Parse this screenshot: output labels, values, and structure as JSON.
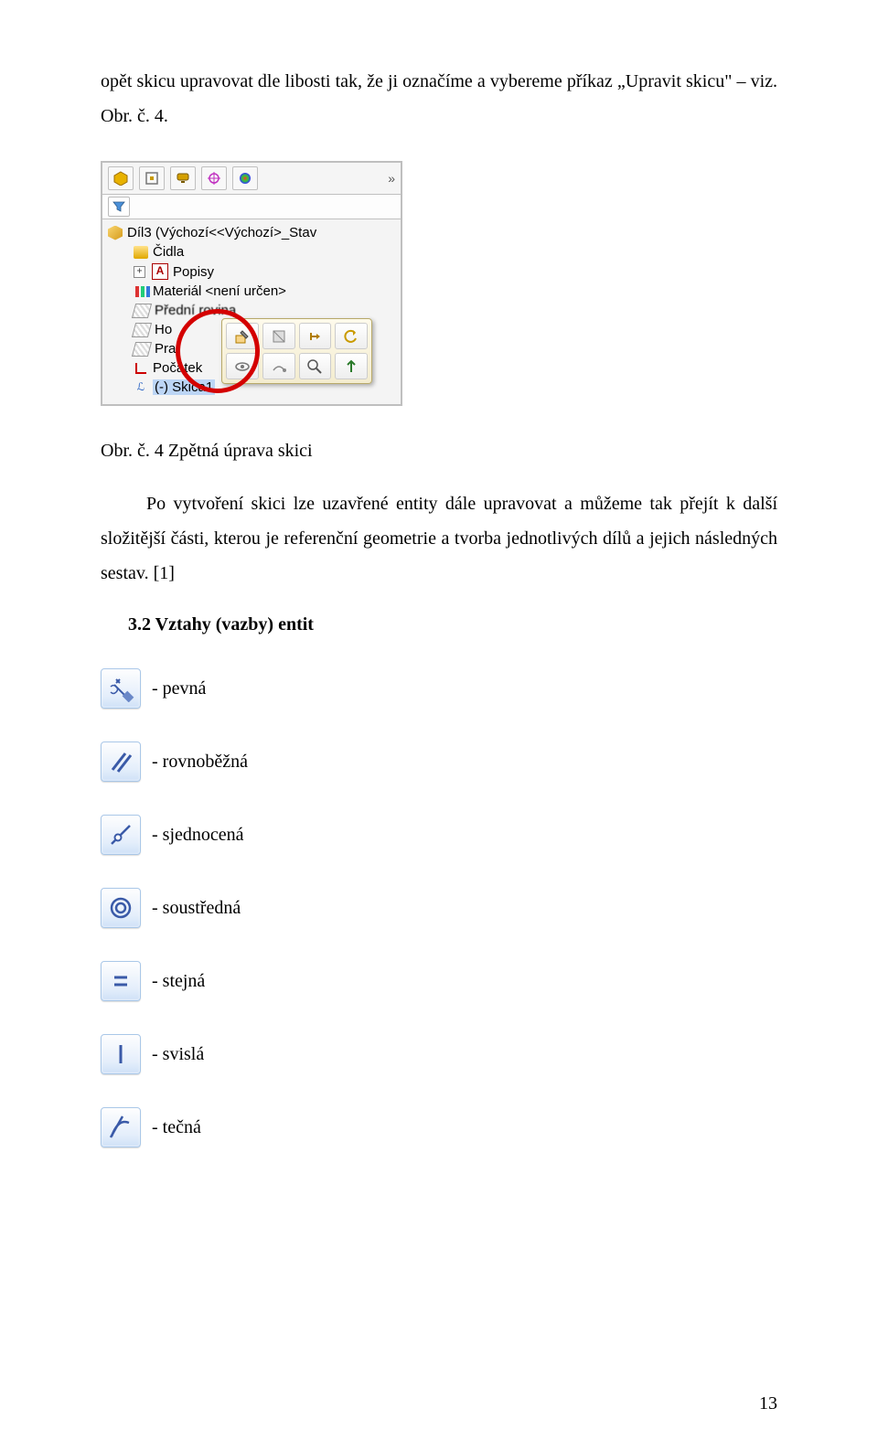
{
  "intro_paragraph": "opět skicu upravovat dle libosti tak, že ji označíme a vybereme příkaz „Upravit skicu\" – viz. Obr. č. 4.",
  "feature_manager": {
    "root": "Díl3 (Výchozí<<Výchozí>_Stav",
    "items": {
      "cidla": "Čidla",
      "popisy": "Popisy",
      "material": "Materiál <není určen>",
      "predni": "Přední rovina",
      "horni": "Ho",
      "prava": "Pra",
      "pocatek": "Počátek",
      "skica": "(-) Skica1"
    }
  },
  "caption": "Obr. č. 4 Zpětná úprava skici",
  "paragraph2": "Po vytvoření skici lze uzavřené entity dále upravovat a můžeme tak přejít k další složitější části, kterou je referenční geometrie a tvorba jednotlivých dílů a jejich následných sestav. [1]",
  "heading": "3.2  Vztahy (vazby) entit",
  "constraints": {
    "pevna": "- pevná",
    "rovnobezna": "- rovnoběžná",
    "sjednocena": "- sjednocená",
    "soustredna": "- soustředná",
    "stejna": "- stejná",
    "svisla": "- svislá",
    "tecna": "- tečná"
  },
  "page_number": "13"
}
